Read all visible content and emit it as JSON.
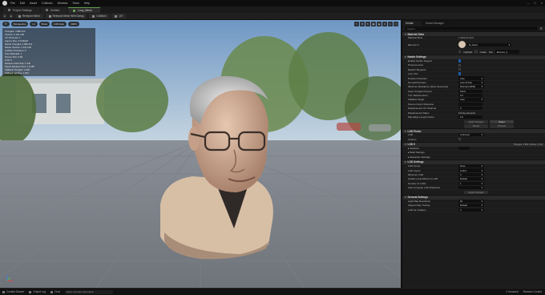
{
  "menu": {
    "items": [
      "File",
      "Edit",
      "Asset",
      "Collision",
      "Window",
      "Tools",
      "Help"
    ]
  },
  "tabs": [
    {
      "label": "Project Settings",
      "active": false
    },
    {
      "label": "Untitled",
      "active": false
    },
    {
      "label": "Lucy_Mesh",
      "active": true
    }
  ],
  "toolbar": {
    "buttons": [
      "Reimport Mesh",
      "Reimport Mesh With Dialog",
      "Collision",
      "UV"
    ]
  },
  "viewport": {
    "buttons": [
      "Perspective",
      "Lit",
      "Show",
      "LOD Auto",
      "100%"
    ],
    "stats_lines": [
      "Triangles: 4 882 214",
      "Vertices: 2 441 109",
      "UV Channels: 1",
      "Approx Size: 27x30x28",
      "Nanite Triangles: 4 882 214",
      "Nanite Vertices: 2 441 109",
      "Collision Primitives: 0",
      "Num Materials: 1",
      "Screen Size: 0.84",
      "LOD: 0",
      "Distance Field Size: 0 KB",
      "Nanite Resident Size: 1.2 MB",
      "Fallback Triangles: 2 000",
      "Fallback Vertices: 1 004"
    ]
  },
  "panel": {
    "tabs": [
      "Details",
      "Socket Manager"
    ],
    "search_placeholder": "Search",
    "sections": {
      "material_slots": "Material Slots",
      "nanite": "Nanite Settings",
      "lod_picker": "LOD Picker",
      "lod0": "LOD 0",
      "lod_settings": "LOD Settings",
      "general": "General Settings"
    },
    "material": {
      "label": "Material Slots",
      "slot_count": "1 Material Slots",
      "element": "Element 0",
      "name_value": "M_Head",
      "highlight": "Highlight",
      "isolate": "Isolate",
      "slot_label": "Slot",
      "slot_value": "Element_0"
    },
    "nanite_rows": [
      {
        "label": "Enable Nanite Support",
        "type": "check",
        "value": true
      },
      {
        "label": "Preserve Area",
        "type": "check",
        "value": false
      },
      {
        "label": "Explicit Tangents",
        "type": "check",
        "value": false
      },
      {
        "label": "Lerp UVs",
        "type": "check",
        "value": true
      },
      {
        "label": "Position Precision",
        "type": "dropdown",
        "value": "Auto"
      },
      {
        "label": "Normal Precision",
        "type": "dropdown",
        "value": "Auto (8 bits)"
      },
      {
        "label": "Minimum Residency (Root Geometry)",
        "type": "dropdown",
        "value": "Minimal (32KB)"
      },
      {
        "label": "Keep Triangle Percent",
        "type": "input",
        "value": "100.0"
      },
      {
        "label": "Trim Relative Error",
        "type": "input",
        "value": "0.0"
      },
      {
        "label": "Fallback Target",
        "type": "dropdown",
        "value": "Auto"
      },
      {
        "label": "Source Import Filename",
        "type": "input",
        "value": ""
      },
      {
        "label": "Displacement UV Channel",
        "type": "input",
        "value": "0"
      },
      {
        "label": "Displacement Maps",
        "type": "text",
        "value": "0 Array elements"
      },
      {
        "label": "Max Edge Length Factor",
        "type": "input",
        "value": "0.0"
      }
    ],
    "nanite_buttons": [
      "Apply Changes",
      "Reset",
      "Revert",
      "Preview"
    ],
    "lod_picker": {
      "label": "LOD",
      "value": "LOD Auto",
      "custom_label": "Custom"
    },
    "lod0": {
      "stats": "Triangles: 4 882   Vertices: 2 441",
      "sections": "Sections",
      "build_settings": "Build Settings",
      "reduction": "Reduction Settings"
    },
    "lod_settings_rows": [
      {
        "label": "LOD Group",
        "value": "None"
      },
      {
        "label": "LOD Import",
        "value": "LOD 0"
      },
      {
        "label": "Minimum LOD",
        "value": "0"
      },
      {
        "label": "Quality Level Minimum LOD",
        "value": "Default"
      },
      {
        "label": "Number of LODs",
        "value": "1"
      },
      {
        "label": "Auto Compute LOD Distances",
        "value": ""
      }
    ],
    "apply_changes": "Apply Changes",
    "general_rows": [
      {
        "label": "Light Map Resolution",
        "value": "64"
      },
      {
        "label": "Support Ray Tracing",
        "value": "Default"
      },
      {
        "label": "LOD for Collision",
        "value": "0"
      }
    ]
  },
  "statusbar": {
    "items": [
      "Content Drawer",
      "Output Log",
      "Cmd"
    ],
    "cmd_placeholder": "Enter Console Command",
    "right": [
      "2 Unsaved",
      "Revision Control"
    ]
  }
}
